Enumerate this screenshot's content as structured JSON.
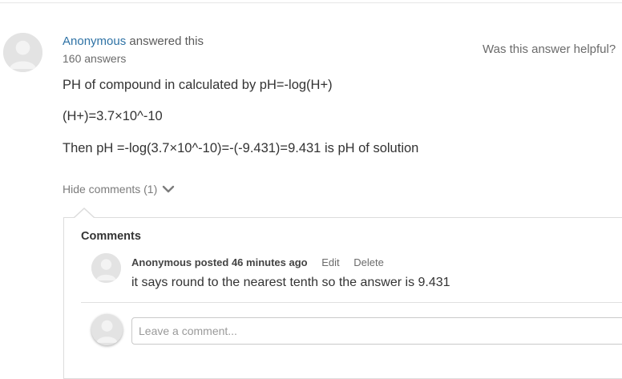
{
  "answer": {
    "author": "Anonymous",
    "author_suffix": "answered this",
    "answer_count": "160 answers",
    "helpful_prompt": "Was this answer helpful?",
    "lines": [
      "PH of compound in calculated by pH=-log(H+)",
      "(H+)=3.7×10^-10",
      "Then pH =-log(3.7×10^-10)=-(-9.431)=9.431 is pH of solution"
    ]
  },
  "comments_toggle": {
    "label": "Hide comments (1)",
    "icon": "chevron-down-icon"
  },
  "comments": {
    "title": "Comments",
    "items": [
      {
        "author_posted": "Anonymous posted 46 minutes ago",
        "edit_label": "Edit",
        "delete_label": "Delete",
        "text": "it says round to the nearest tenth so the answer is 9.431"
      }
    ],
    "new_comment": {
      "placeholder": "Leave a comment..."
    }
  },
  "colors": {
    "link": "#2e72a5",
    "text": "#333333",
    "muted": "#6b6b6b",
    "border": "#dcdcdc"
  }
}
